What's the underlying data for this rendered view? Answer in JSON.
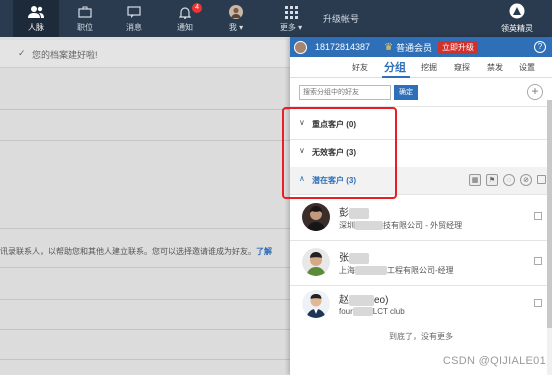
{
  "nav": {
    "items": [
      {
        "label": "人脉",
        "icon": "people-icon"
      },
      {
        "label": "职位",
        "icon": "briefcase-icon"
      },
      {
        "label": "消息",
        "icon": "message-icon"
      },
      {
        "label": "通知",
        "icon": "bell-icon",
        "badge": "4"
      },
      {
        "label": "我",
        "icon": "avatar"
      },
      {
        "label": "更多",
        "icon": "grid-icon"
      }
    ],
    "upgrade_account": "升级帐号",
    "logo_label": "领英精灵"
  },
  "background": {
    "notice": "您的档案建好啦!",
    "body_text": "讯录联系人，以帮助您和其他人建立联系。您可以选择邀请谁成为好友。",
    "body_link": "了解"
  },
  "panel": {
    "phone": "18172814387",
    "member_level": "普通会员",
    "upgrade_button": "立即升级",
    "help": "?",
    "tabs": [
      "好友",
      "分组",
      "挖掘",
      "窥探",
      "禁发",
      "设置"
    ],
    "search_placeholder": "搜索分组中的好友",
    "search_button": "确定",
    "groups": [
      {
        "name": "重点客户",
        "count": "(0)"
      },
      {
        "name": "无效客户",
        "count": "(3)"
      },
      {
        "name": "潜在客户",
        "count": "(3)"
      }
    ],
    "contacts": [
      {
        "name_a": "彭",
        "name_b": "",
        "desc_a": "深圳",
        "desc_b": "技有限公司 - 外贸经理"
      },
      {
        "name_a": "张",
        "name_b": "",
        "desc_a": "上海",
        "desc_b": "工程有限公司-经理"
      },
      {
        "name_a": "赵",
        "name_b": "eo)",
        "desc_a": "four",
        "desc_b": "LCT club"
      }
    ],
    "end_text": "到底了，没有更多"
  },
  "watermark": "CSDN @QIJIALE01"
}
